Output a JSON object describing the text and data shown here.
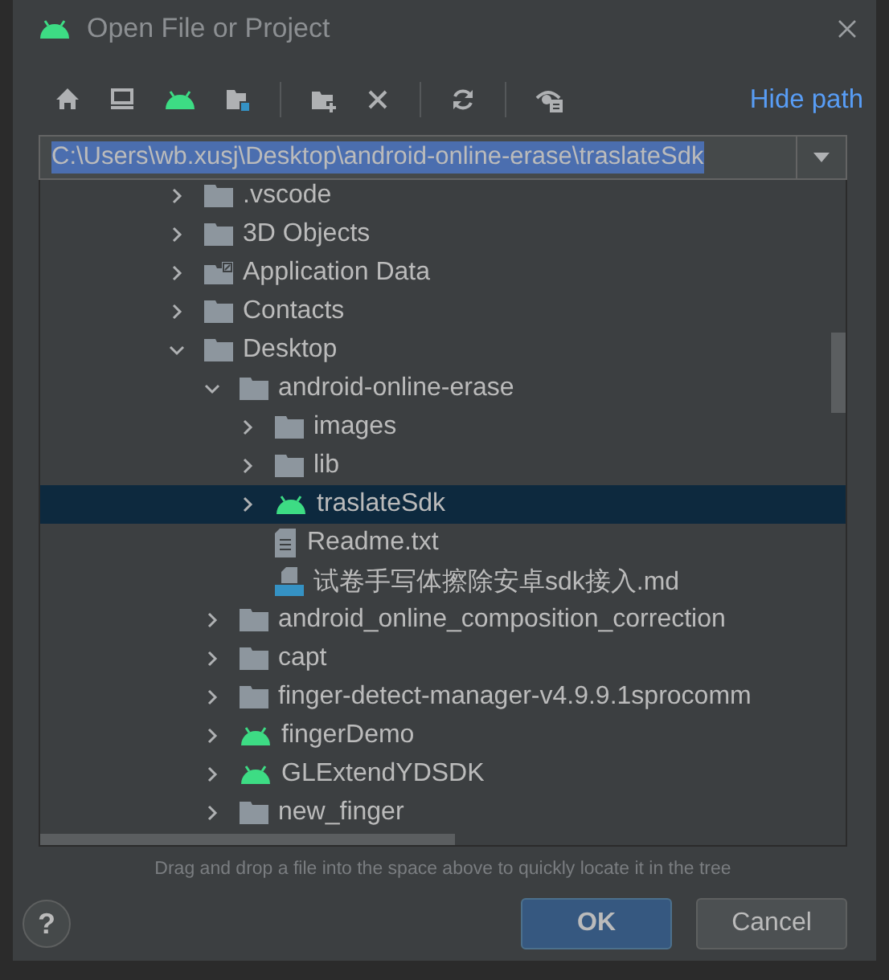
{
  "window": {
    "title": "Open File or Project"
  },
  "toolbar": {
    "hide_path_link": "Hide path"
  },
  "path_field": {
    "value": "C:\\Users\\wb.xusj\\Desktop\\android-online-erase\\traslateSdk",
    "text_selected": true
  },
  "tree": [
    {
      "name": ".vscode",
      "kind": "folder",
      "expanded": false,
      "selected": false
    },
    {
      "name": "3D Objects",
      "kind": "folder",
      "expanded": false,
      "selected": false
    },
    {
      "name": "Application Data",
      "kind": "shortcut-folder",
      "expanded": false,
      "selected": false
    },
    {
      "name": "Contacts",
      "kind": "folder",
      "expanded": false,
      "selected": false
    },
    {
      "name": "Desktop",
      "kind": "folder",
      "expanded": true,
      "selected": false,
      "children": [
        {
          "name": "android-online-erase",
          "kind": "folder",
          "expanded": true,
          "selected": false,
          "children": [
            {
              "name": "images",
              "kind": "folder",
              "expanded": false,
              "selected": false
            },
            {
              "name": "lib",
              "kind": "folder",
              "expanded": false,
              "selected": false
            },
            {
              "name": "traslateSdk",
              "kind": "android",
              "expanded": false,
              "selected": true
            },
            {
              "name": "Readme.txt",
              "kind": "text-file",
              "selected": false
            },
            {
              "name": "试卷手写体擦除安卓sdk接入.md",
              "kind": "md-file",
              "selected": false
            }
          ]
        },
        {
          "name": "android_online_composition_correction",
          "kind": "folder",
          "expanded": false,
          "selected": false
        },
        {
          "name": "capt",
          "kind": "folder",
          "expanded": false,
          "selected": false
        },
        {
          "name": "finger-detect-manager-v4.9.9.1sprocomm",
          "kind": "folder",
          "expanded": false,
          "selected": false
        },
        {
          "name": "fingerDemo",
          "kind": "android",
          "expanded": false,
          "selected": false
        },
        {
          "name": "GLExtendYDSDK",
          "kind": "android",
          "expanded": false,
          "selected": false
        },
        {
          "name": "new_finger",
          "kind": "folder",
          "expanded": false,
          "selected": false
        }
      ]
    }
  ],
  "hint": "Drag and drop a file into the space above to quickly locate it in the tree",
  "help_button": "?",
  "buttons": [
    {
      "label": "OK",
      "kind": "primary"
    },
    {
      "label": "Cancel",
      "kind": "secondary"
    }
  ]
}
